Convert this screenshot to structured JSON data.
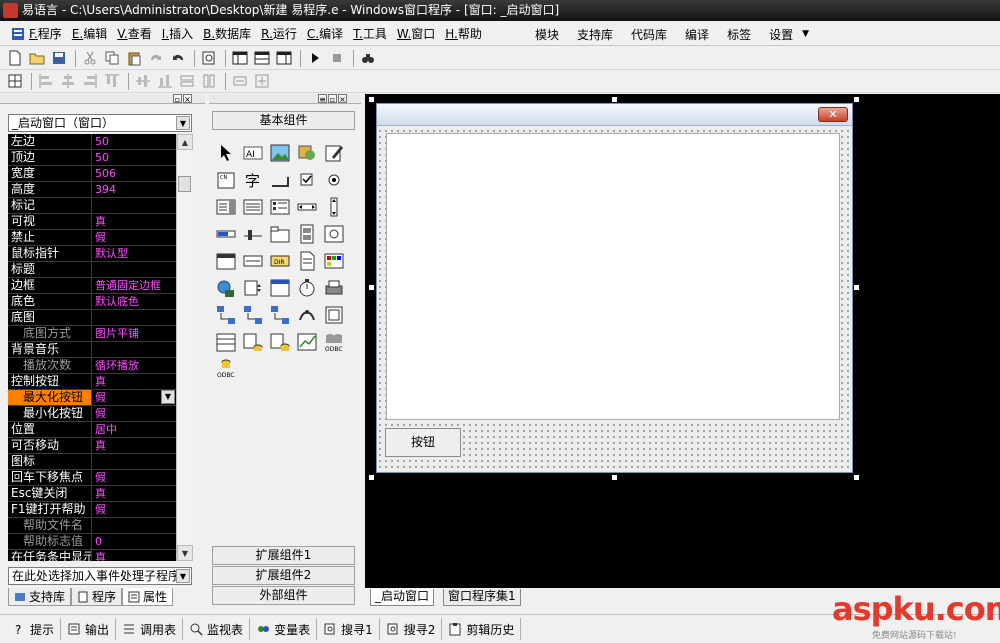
{
  "titlebar": {
    "text": "易语言 - C:\\Users\\Administrator\\Desktop\\新建 易程序.e - Windows窗口程序 - [窗口: _启动窗口]"
  },
  "menubar": {
    "items": [
      {
        "key": "F.",
        "label": "程序"
      },
      {
        "key": "E.",
        "label": "编辑"
      },
      {
        "key": "V.",
        "label": "查看"
      },
      {
        "key": "I.",
        "label": "插入"
      },
      {
        "key": "B.",
        "label": "数据库"
      },
      {
        "key": "R.",
        "label": "运行"
      },
      {
        "key": "C.",
        "label": "编译"
      },
      {
        "key": "T.",
        "label": "工具"
      },
      {
        "key": "W.",
        "label": "窗口"
      },
      {
        "key": "H.",
        "label": "帮助"
      }
    ],
    "right_items": [
      "模块",
      "支持库",
      "代码库",
      "编译",
      "标签",
      "设置"
    ]
  },
  "left_panel": {
    "combo_value": "_启动窗口（窗口）",
    "properties": [
      {
        "name": "左边",
        "value": "50"
      },
      {
        "name": "顶边",
        "value": "50"
      },
      {
        "name": "宽度",
        "value": "506"
      },
      {
        "name": "高度",
        "value": "394"
      },
      {
        "name": "标记",
        "value": ""
      },
      {
        "name": "可视",
        "value": "真"
      },
      {
        "name": "禁止",
        "value": "假"
      },
      {
        "name": "鼠标指针",
        "value": "默认型"
      },
      {
        "name": "标题",
        "value": ""
      },
      {
        "name": "边框",
        "value": "普通固定边框"
      },
      {
        "name": "底色",
        "value": "默认底色"
      },
      {
        "name": "底图",
        "value": ""
      },
      {
        "name": "底图方式",
        "value": "图片平铺"
      },
      {
        "name": "背景音乐",
        "value": ""
      },
      {
        "name": "播放次数",
        "value": "循环播放"
      },
      {
        "name": "控制按钮",
        "value": "真"
      },
      {
        "name": "最大化按钮",
        "value": "假"
      },
      {
        "name": "最小化按钮",
        "value": "假"
      },
      {
        "name": "位置",
        "value": "居中"
      },
      {
        "name": "可否移动",
        "value": "真"
      },
      {
        "name": "图标",
        "value": ""
      },
      {
        "name": "回车下移焦点",
        "value": "假"
      },
      {
        "name": "Esc键关闭",
        "value": "真"
      },
      {
        "name": "F1键打开帮助",
        "value": "假"
      },
      {
        "name": "帮助文件名",
        "value": ""
      },
      {
        "name": "帮助标志值",
        "value": "0"
      },
      {
        "name": "在任务条中显示",
        "value": "真"
      }
    ],
    "event_combo": "在此处选择加入事件处理子程序",
    "tabs": [
      "支持库",
      "程序",
      "属性"
    ]
  },
  "mid_panel": {
    "basic_group": "基本组件",
    "groups": [
      "扩展组件1",
      "扩展组件2",
      "外部组件"
    ]
  },
  "designer": {
    "form_button_label": "按钮",
    "tabs": [
      "_启动窗口",
      "窗口程序集1"
    ]
  },
  "bottom_bar": {
    "items": [
      "提示",
      "输出",
      "调用表",
      "监视表",
      "变量表",
      "搜寻1",
      "搜寻2",
      "剪辑历史"
    ]
  },
  "watermark": {
    "main": "aspku.com",
    "sub": "免费网站源码下载站!"
  },
  "colors": {
    "prop_value": "#ff4bff",
    "selected_row": "#ff8000",
    "grid_bg": "#000000"
  }
}
